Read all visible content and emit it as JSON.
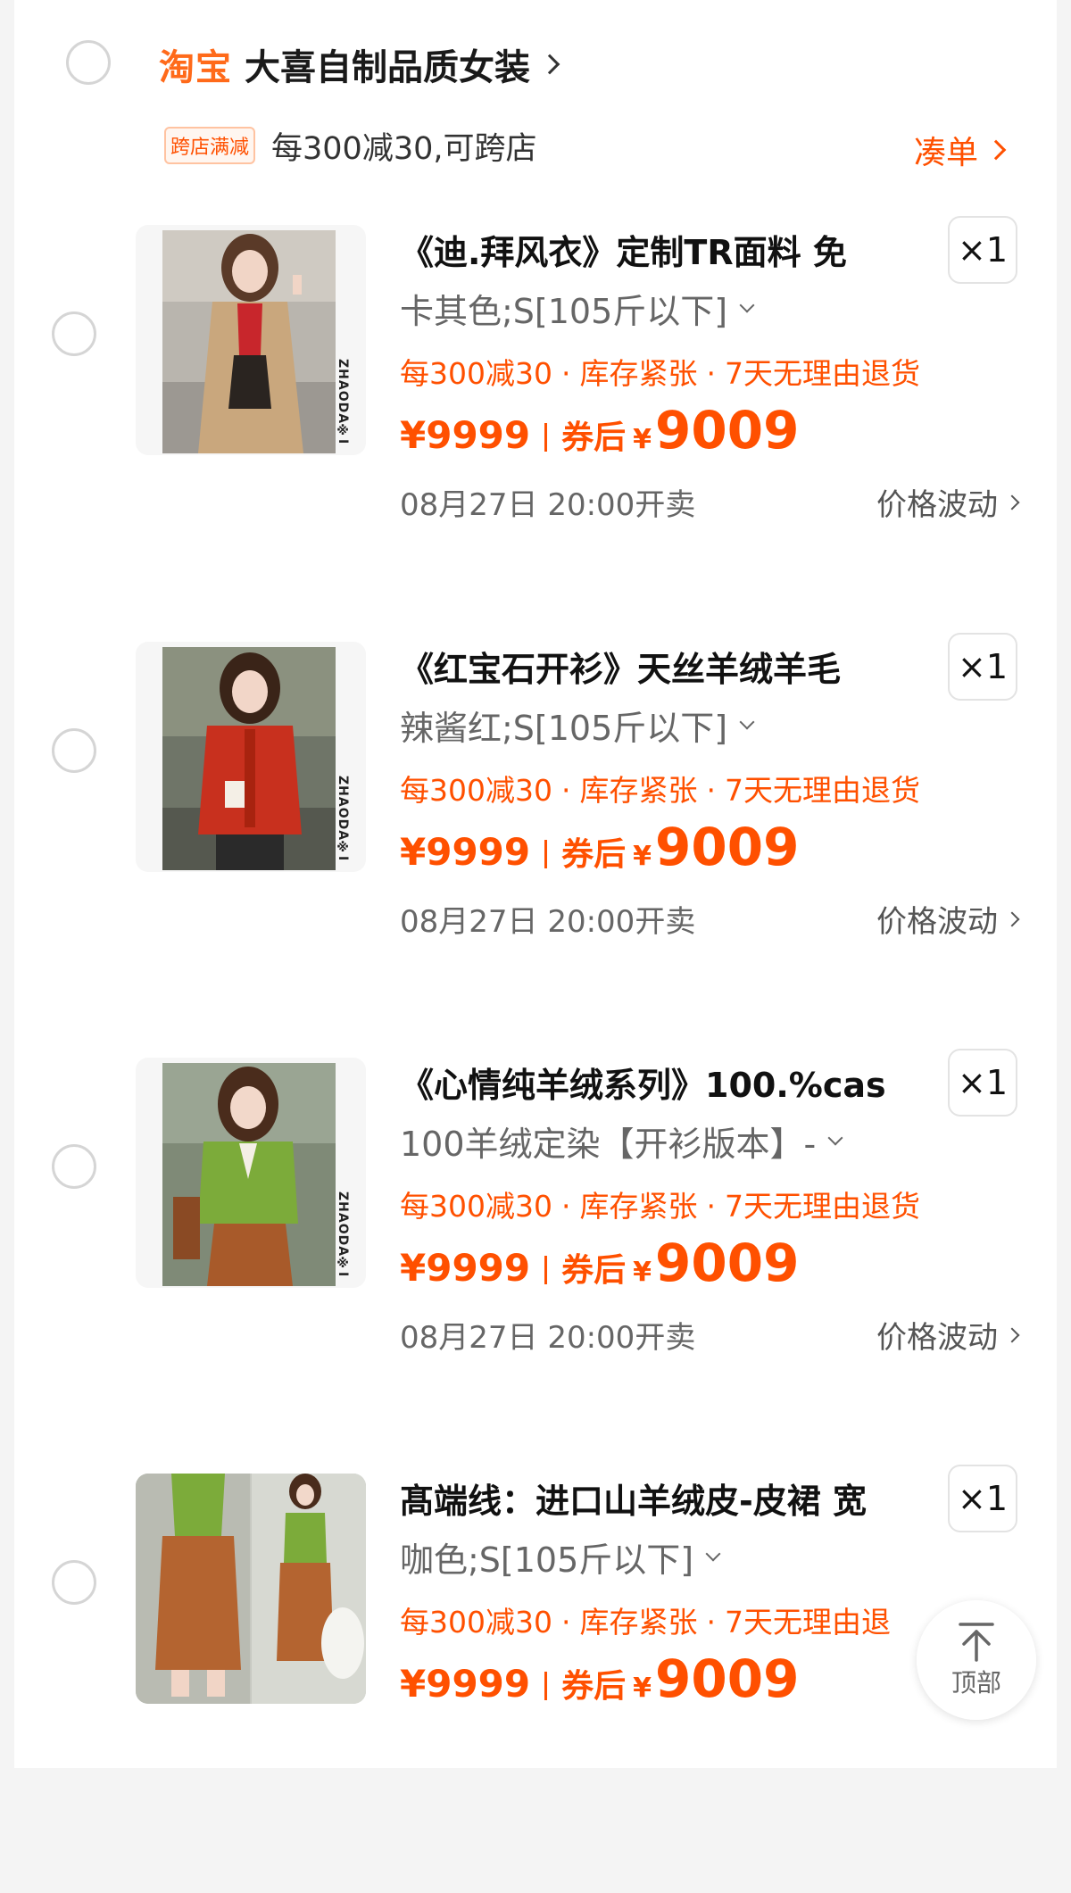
{
  "shop": {
    "logo": "淘宝",
    "name": "大喜自制品质女装",
    "promo_tag": "跨店满减",
    "promo_text": "每300减30,可跨店",
    "add_on_label": "凑单"
  },
  "items": [
    {
      "title": "《迪.拜风衣》定制TR面料 免",
      "spec": "卡其色;S[105斤以下]",
      "tags": [
        "每300减30",
        "库存紧张",
        "7天无理由退货"
      ],
      "price": "¥9999",
      "coupon_label": "券后",
      "coupon_symbol": "¥",
      "coupon_price": "9009",
      "sale_time": "08月27日 20:00开卖",
      "fluctuation_label": "价格波动",
      "quantity": "×1",
      "brand_mark": "ZHAODA※I"
    },
    {
      "title": "《红宝石开衫》天丝羊绒羊毛",
      "spec": "辣酱红;S[105斤以下]",
      "tags": [
        "每300减30",
        "库存紧张",
        "7天无理由退货"
      ],
      "price": "¥9999",
      "coupon_label": "券后",
      "coupon_symbol": "¥",
      "coupon_price": "9009",
      "sale_time": "08月27日 20:00开卖",
      "fluctuation_label": "价格波动",
      "quantity": "×1",
      "brand_mark": "ZHAODA※I"
    },
    {
      "title": "《心情纯羊绒系列》100.%cas",
      "spec": "100羊绒定染【开衫版本】-",
      "tags": [
        "每300减30",
        "库存紧张",
        "7天无理由退货"
      ],
      "price": "¥9999",
      "coupon_label": "券后",
      "coupon_symbol": "¥",
      "coupon_price": "9009",
      "sale_time": "08月27日 20:00开卖",
      "fluctuation_label": "价格波动",
      "quantity": "×1",
      "brand_mark": "ZHAODA※I"
    },
    {
      "title": "髙端线：进口山羊绒皮-皮裙 宽",
      "spec": "咖色;S[105斤以下]",
      "tags": [
        "每300减30",
        "库存紧张",
        "7天无理由退"
      ],
      "price": "¥9999",
      "coupon_label": "券后",
      "coupon_symbol": "¥",
      "coupon_price": "9009",
      "quantity": "×1"
    }
  ],
  "back_to_top": {
    "label": "顶部",
    "icon": "arrow-up-to-top-icon"
  },
  "colors": {
    "accent": "#ff5000",
    "text": "#222222",
    "muted": "#666666"
  }
}
